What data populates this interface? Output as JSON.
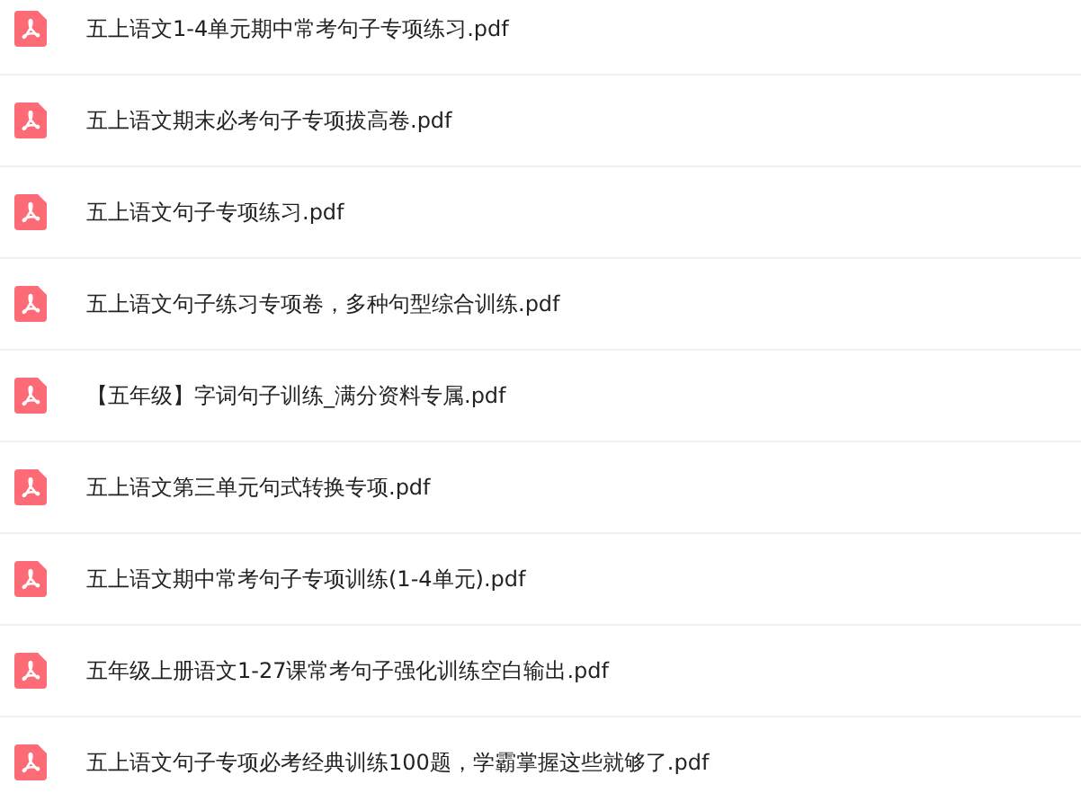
{
  "files": [
    {
      "name": "五上语文1-4单元期中常考句子专项练习.pdf"
    },
    {
      "name": "五上语文期末必考句子专项拔高卷.pdf"
    },
    {
      "name": "五上语文句子专项练习.pdf"
    },
    {
      "name": "五上语文句子练习专项卷，多种句型综合训练.pdf"
    },
    {
      "name": "【五年级】字词句子训练_满分资料专属.pdf"
    },
    {
      "name": "五上语文第三单元句式转换专项.pdf"
    },
    {
      "name": "五上语文期中常考句子专项训练(1-4单元).pdf"
    },
    {
      "name": "五年级上册语文1-27课常考句子强化训练空白输出.pdf"
    },
    {
      "name": "五上语文句子专项必考经典训练100题，学霸掌握这些就够了.pdf"
    }
  ]
}
